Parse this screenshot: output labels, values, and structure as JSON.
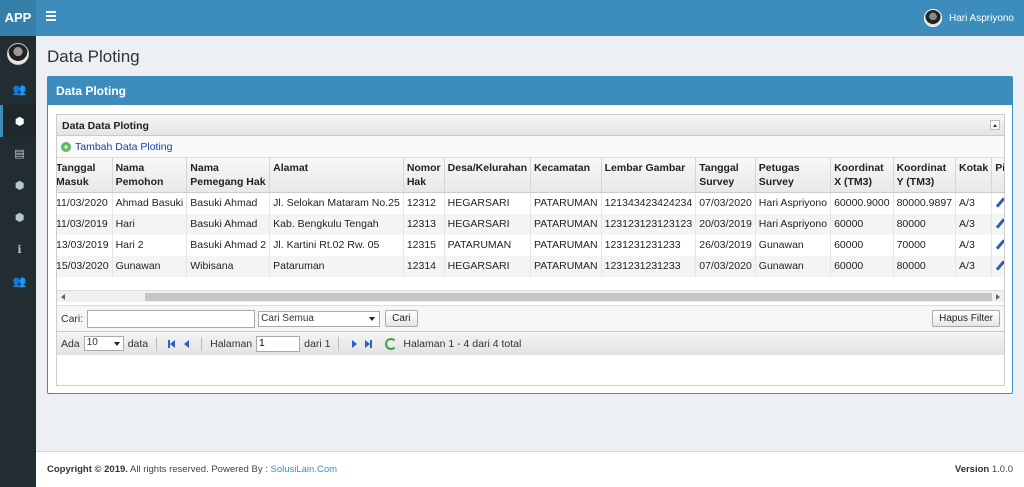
{
  "app": {
    "brand": "APP"
  },
  "user": {
    "name": "Hari Aspriyono"
  },
  "sidebar": {
    "items": [
      {
        "icon": "users-icon",
        "glyph": "👥"
      },
      {
        "icon": "cube-icon",
        "glyph": "⬢",
        "active": true
      },
      {
        "icon": "pdf-icon",
        "glyph": "▤"
      },
      {
        "icon": "cube-icon",
        "glyph": "⬢"
      },
      {
        "icon": "cube-icon",
        "glyph": "⬢"
      },
      {
        "icon": "info-icon",
        "glyph": "ℹ"
      },
      {
        "icon": "users-icon",
        "glyph": "👥"
      }
    ]
  },
  "page": {
    "title": "Data Ploting"
  },
  "box": {
    "title": "Data Ploting"
  },
  "grid": {
    "caption": "Data Data Ploting",
    "add_label": "Tambah Data Ploting",
    "columns": [
      "Tanggal Masuk",
      "Nama Pemohon",
      "Nama Pemegang Hak",
      "Alamat",
      "Nomor Hak",
      "Desa/Kelurahan",
      "Kecamatan",
      "Lembar Gambar",
      "Tanggal Survey",
      "Petugas Survey",
      "Koordinat X (TM3)",
      "Koordinat Y (TM3)",
      "Kotak",
      "Pilihan"
    ],
    "rows": [
      [
        "11/03/2020",
        "Ahmad Basuki",
        "Basuki Ahmad",
        "Jl. Selokan Mataram No.25",
        "12312",
        "HEGARSARI",
        "PATARUMAN",
        "121343423424234",
        "07/03/2020",
        "Hari Aspriyono",
        "60000.9000",
        "80000.9897",
        "A/3"
      ],
      [
        "11/03/2019",
        "Hari",
        "Basuki Ahmad",
        "Kab. Bengkulu Tengah",
        "12313",
        "HEGARSARI",
        "PATARUMAN",
        "123123123123123",
        "20/03/2019",
        "Hari Aspriyono",
        "60000",
        "80000",
        "A/3"
      ],
      [
        "13/03/2019",
        "Hari 2",
        "Basuki Ahmad 2",
        "Jl. Kartini Rt.02 Rw. 05",
        "12315",
        "PATARUMAN",
        "PATARUMAN",
        "1231231231233",
        "26/03/2019",
        "Gunawan",
        "60000",
        "70000",
        "A/3"
      ],
      [
        "15/03/2020",
        "Gunawan",
        "Wibisana",
        "Pataruman",
        "12314",
        "HEGARSARI",
        "PATARUMAN",
        "1231231231233",
        "07/03/2020",
        "Gunawan",
        "60000",
        "80000",
        "A/3"
      ]
    ]
  },
  "search": {
    "label": "Cari:",
    "value": "",
    "field_selected": "Cari Semua",
    "button": "Cari",
    "clear_button": "Hapus Filter"
  },
  "pager": {
    "prefix": "Ada",
    "page_size": "10",
    "suffix": "data",
    "page_label": "Halaman",
    "page_value": "1",
    "of_label": "dari 1",
    "summary": "Halaman 1 - 4 dari 4 total"
  },
  "footer": {
    "copyright": "Copyright © 2019.",
    "rights": " All rights reserved. Powered By : ",
    "powered": "SolusiLain.Com",
    "version_label": "Version",
    "version": " 1.0.0"
  }
}
